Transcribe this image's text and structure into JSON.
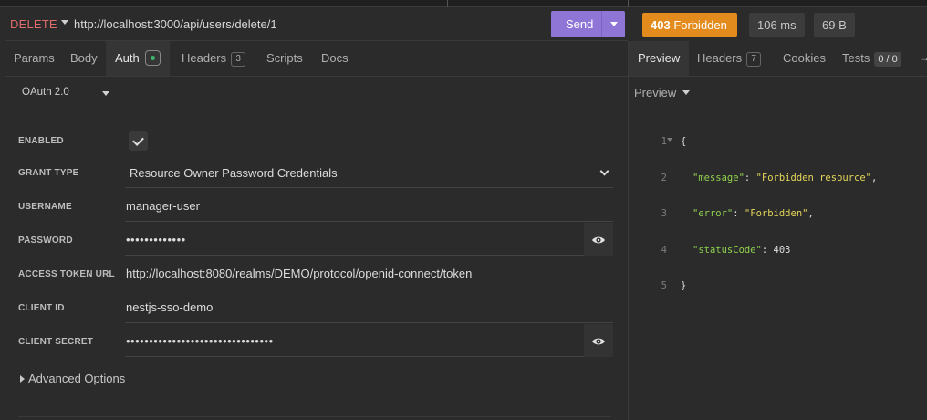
{
  "request": {
    "method": "DELETE",
    "url": "http://localhost:3000/api/users/delete/1",
    "send_label": "Send"
  },
  "request_tabs": [
    {
      "label": "Params"
    },
    {
      "label": "Body"
    },
    {
      "label": "Auth"
    },
    {
      "label": "Headers",
      "badge": "3"
    },
    {
      "label": "Scripts"
    },
    {
      "label": "Docs"
    }
  ],
  "auth": {
    "type": "OAuth 2.0",
    "fields": {
      "enabled_label": "ENABLED",
      "grant_type_label": "GRANT TYPE",
      "grant_type_value": "Resource Owner Password Credentials",
      "username_label": "USERNAME",
      "username_value": "manager-user",
      "password_label": "PASSWORD",
      "password_value": "•••••••••••••",
      "token_url_label": "ACCESS TOKEN URL",
      "token_url_value": "http://localhost:8080/realms/DEMO/protocol/openid-connect/token",
      "client_id_label": "CLIENT ID",
      "client_id_value": "nestjs-sso-demo",
      "client_secret_label": "CLIENT SECRET",
      "client_secret_value": "••••••••••••••••••••••••••••••••"
    },
    "enabled": true,
    "advanced_label": "Advanced Options"
  },
  "response": {
    "status_code": "403",
    "status_text": "Forbidden",
    "time": "106 ms",
    "size": "69 B",
    "status_color": "#e38b1d",
    "tabs": [
      {
        "label": "Preview"
      },
      {
        "label": "Headers",
        "badge": "7"
      },
      {
        "label": "Cookies"
      },
      {
        "label": "Tests",
        "badge": "0 / 0"
      }
    ],
    "preview_mode": "Preview",
    "body_lines": [
      {
        "n": "1",
        "text": "{"
      },
      {
        "n": "2",
        "key": "\"message\"",
        "value": "\"Forbidden resource\"",
        "trail": ","
      },
      {
        "n": "3",
        "key": "\"error\"",
        "value": "\"Forbidden\"",
        "trail": ","
      },
      {
        "n": "4",
        "key": "\"statusCode\"",
        "value": "403",
        "trail": ""
      },
      {
        "n": "5",
        "text": "}"
      }
    ]
  }
}
